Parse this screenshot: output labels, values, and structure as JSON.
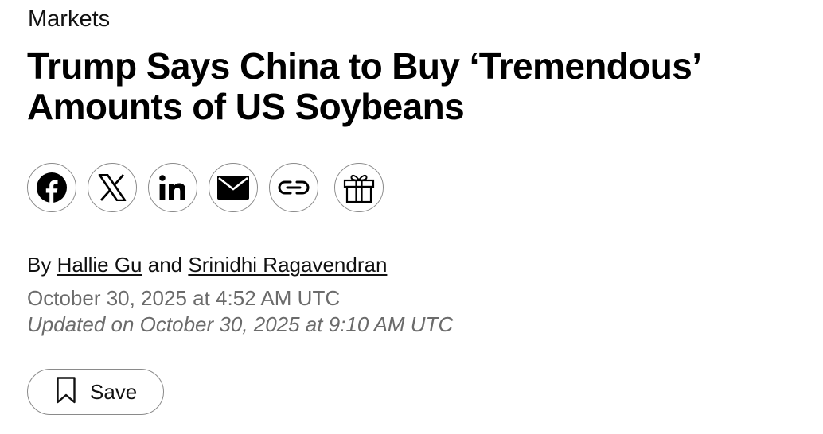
{
  "section": {
    "label": "Markets"
  },
  "headline": {
    "line1": "Trump Says China to Buy ‘Tremendous’",
    "line2": "Amounts of US Soybeans"
  },
  "share": {
    "buttons": [
      {
        "name": "facebook",
        "icon": "facebook-icon"
      },
      {
        "name": "x",
        "icon": "x-icon"
      },
      {
        "name": "linkedin",
        "icon": "linkedin-icon"
      },
      {
        "name": "email",
        "icon": "envelope-icon"
      },
      {
        "name": "copy-link",
        "icon": "link-icon"
      },
      {
        "name": "gift",
        "icon": "gift-icon"
      }
    ]
  },
  "byline": {
    "prefix": "By",
    "author1": "Hallie Gu",
    "conjunction": "and",
    "author2": "Srinidhi Ragavendran"
  },
  "published": "October 30, 2025 at 4:52 AM UTC",
  "updated": "Updated on October 30, 2025 at 9:10 AM UTC",
  "save": {
    "label": "Save",
    "icon": "bookmark-icon"
  },
  "colors": {
    "text": "#000000",
    "muted": "#6b6b6b",
    "border": "#8a8a8a",
    "background": "#ffffff"
  }
}
